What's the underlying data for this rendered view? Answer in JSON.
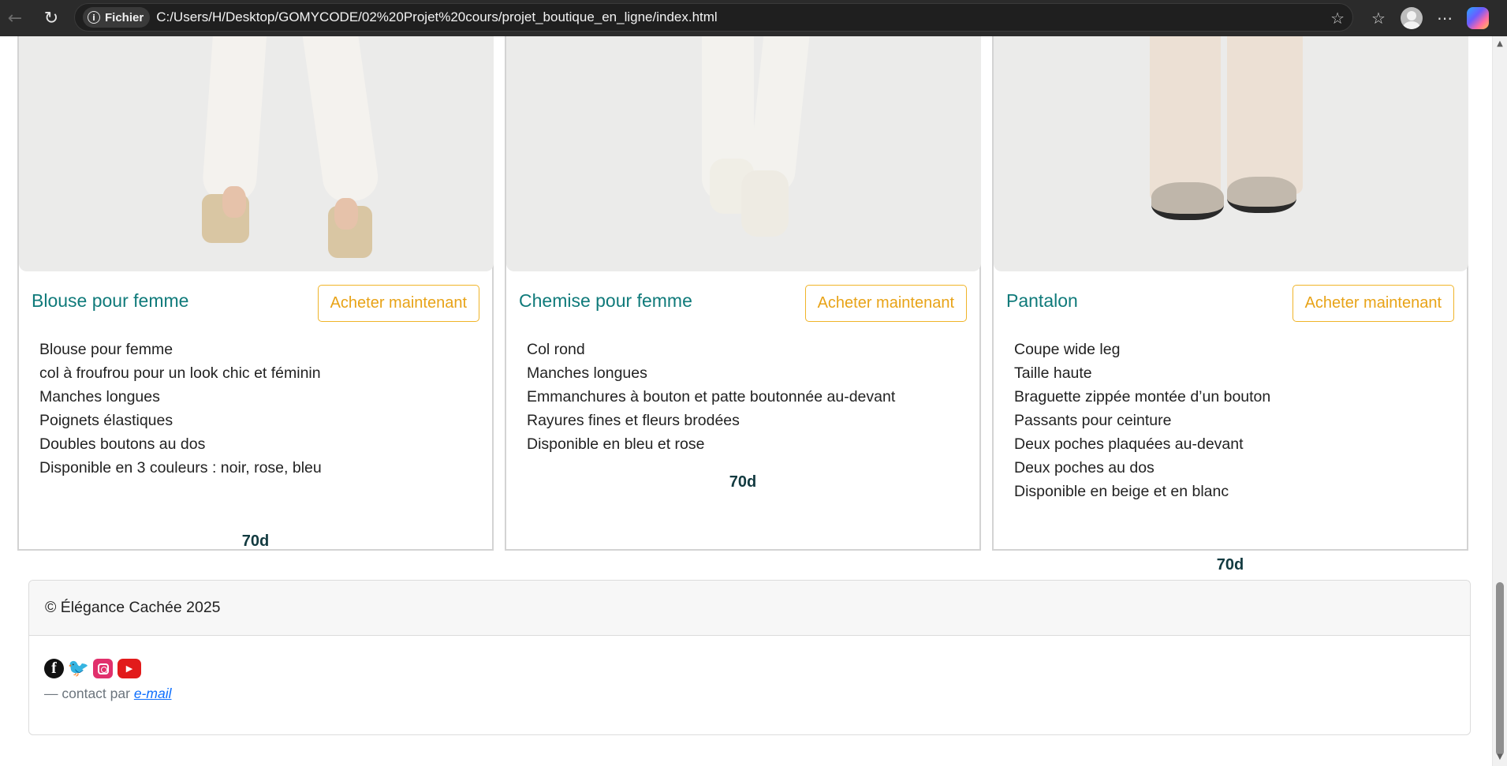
{
  "browser": {
    "site_info_label": "Fichier",
    "url": "C:/Users/H/Desktop/GOMYCODE/02%20Projet%20cours/projet_boutique_en_ligne/index.html"
  },
  "products": [
    {
      "title": "Blouse pour femme",
      "button": "Acheter maintenant",
      "features": [
        "Blouse pour femme",
        "col à froufrou pour un look chic et féminin",
        "Manches longues",
        "Poignets élastiques",
        "Doubles boutons au dos",
        "Disponible en 3 couleurs : noir, rose, bleu"
      ],
      "price": "70d"
    },
    {
      "title": "Chemise pour femme",
      "button": "Acheter maintenant",
      "features": [
        "Col rond",
        "Manches longues",
        "Emmanchures à bouton et patte boutonnée au-devant",
        "Rayures fines et fleurs brodées",
        "Disponible en bleu et rose"
      ],
      "price": "70d"
    },
    {
      "title": "Pantalon",
      "button": "Acheter maintenant",
      "features": [
        "Coupe wide leg",
        "Taille haute",
        "Braguette zippée montée d’un bouton",
        "Passants pour ceinture",
        "Deux poches plaquées au-devant",
        "Deux poches au dos",
        "Disponible en beige et en blanc"
      ],
      "price": "70d"
    }
  ],
  "footer": {
    "copyright": "© Élégance Cachée 2025",
    "contact_prefix": "— contact par",
    "contact_link": "e-mail",
    "socials": [
      "facebook-icon",
      "twitter-icon",
      "instagram-icon",
      "youtube-icon"
    ]
  },
  "colors": {
    "title": "#0f7a7a",
    "button_border": "#f0b429",
    "price": "#123a40",
    "link": "#0d6efd"
  }
}
